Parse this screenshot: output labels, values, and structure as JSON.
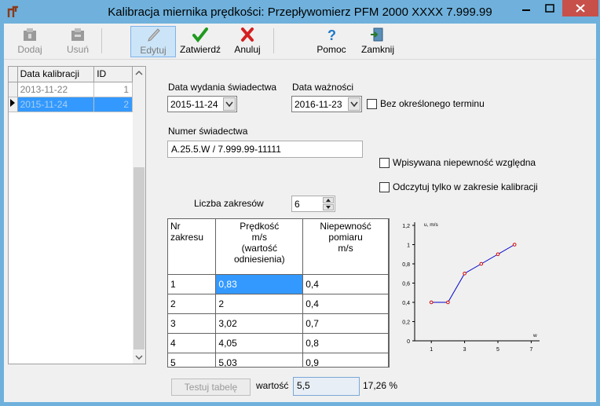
{
  "window": {
    "title": "Kalibracja miernika prędkości: Przepływomierz PFM 2000 XXXX 7.999.99"
  },
  "toolbar": {
    "dodaj": "Dodaj",
    "usun": "Usuń",
    "edytuj": "Edytuj",
    "zatwierdz": "Zatwierdź",
    "anuluj": "Anuluj",
    "pomoc": "Pomoc",
    "zamknij": "Zamknij"
  },
  "calibrations": {
    "headers": [
      "Data kalibracji",
      "ID"
    ],
    "rows": [
      {
        "date": "2013-11-22",
        "id": "1"
      },
      {
        "date": "2015-11-24",
        "id": "2"
      }
    ]
  },
  "form": {
    "issue_date_label": "Data wydania świadectwa",
    "issue_date": "2015-11-24",
    "validity_label": "Data ważności",
    "validity_date": "2016-11-23",
    "no_term_label": "Bez określonego terminu",
    "cert_number_label": "Numer świadectwa",
    "cert_number": "A.25.5.W / 7.999.99-11111",
    "relative_uncertainty_label": "Wpisywana niepewność względna",
    "read_in_range_label": "Odczytuj tylko w zakresie kalibracji",
    "range_count_label": "Liczba zakresów",
    "range_count": "6"
  },
  "ranges": {
    "headers": [
      "Nr zakresu",
      "Prędkość\nm/s\n(wartość\nodniesienia)",
      "Niepewność\npomiaru\nm/s"
    ],
    "rows": [
      {
        "nr": "1",
        "speed": "0,83",
        "unc": "0,4"
      },
      {
        "nr": "2",
        "speed": "2",
        "unc": "0,4"
      },
      {
        "nr": "3",
        "speed": "3,02",
        "unc": "0,7"
      },
      {
        "nr": "4",
        "speed": "4,05",
        "unc": "0,8"
      },
      {
        "nr": "5",
        "speed": "5,03",
        "unc": "0,9"
      }
    ]
  },
  "chart_data": {
    "type": "line",
    "ylabel": "u, m/s",
    "xlabel": "w",
    "x": [
      1,
      2,
      3,
      4,
      5,
      6
    ],
    "y": [
      0.4,
      0.4,
      0.7,
      0.8,
      0.9,
      1.0
    ],
    "xlim": [
      0,
      7.5
    ],
    "ylim": [
      0,
      1.2
    ],
    "xticks": [
      "1",
      "3",
      "5",
      "7"
    ],
    "yticks": [
      "0",
      "0,2",
      "0,4",
      "0,6",
      "0,8",
      "1",
      "1,2"
    ],
    "line_color": "#0000cc",
    "marker_color": "#cc0000"
  },
  "footer": {
    "test_button": "Testuj tabelę",
    "value_label": "wartość",
    "value": "5,5",
    "result": "17,26 %"
  }
}
